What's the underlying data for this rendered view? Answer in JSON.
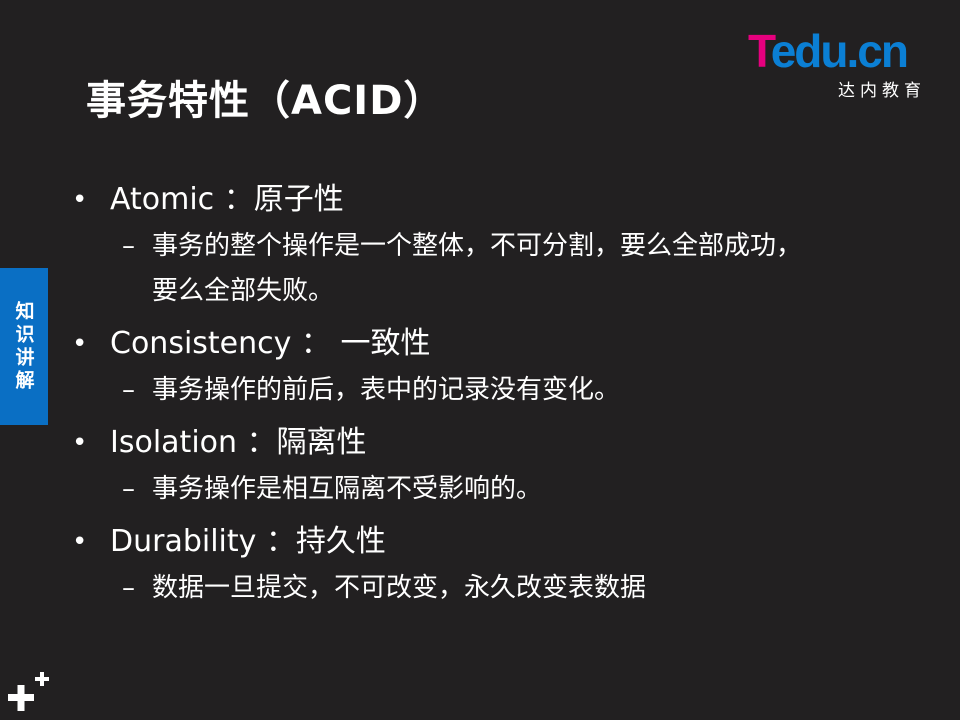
{
  "slide": {
    "title": "事务特性（ACID）"
  },
  "logo": {
    "brand_t": "T",
    "brand_rest": "edu.cn",
    "subtitle": "达内教育",
    "colors": {
      "t": "#e6007e",
      "rest": "#0b7fd4"
    }
  },
  "side_tab": {
    "label": "知识讲解",
    "color": "#0a6fc4"
  },
  "bullets": [
    {
      "mark": "•",
      "text": "Atomic ：原子性",
      "sub_mark": "–",
      "sub": "事务的整个操作是一个整体，不可分割，要么全部成功，要么全部失败。"
    },
    {
      "mark": "•",
      "text": "Consistency ： 一致性",
      "sub_mark": "–",
      "sub": "事务操作的前后，表中的记录没有变化。"
    },
    {
      "mark": "•",
      "text": "Isolation ：隔离性",
      "sub_mark": "–",
      "sub": "事务操作是相互隔离不受影响的。"
    },
    {
      "mark": "•",
      "text": "Durability ：持久性",
      "sub_mark": "–",
      "sub": "数据一旦提交，不可改变，永久改变表数据"
    }
  ],
  "decor": {
    "corner_icon": "plus-plus-icon"
  }
}
